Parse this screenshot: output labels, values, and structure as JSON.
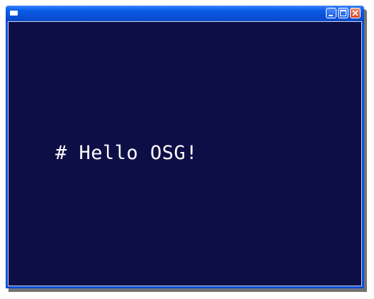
{
  "window": {
    "title": "",
    "controls": {
      "minimize_icon": "minimize-icon",
      "maximize_icon": "maximize-icon",
      "close_icon": "close-icon"
    }
  },
  "viewport": {
    "text": "# Hello OSG!",
    "background_color": "#0e0e47",
    "text_color": "#ffffff"
  }
}
